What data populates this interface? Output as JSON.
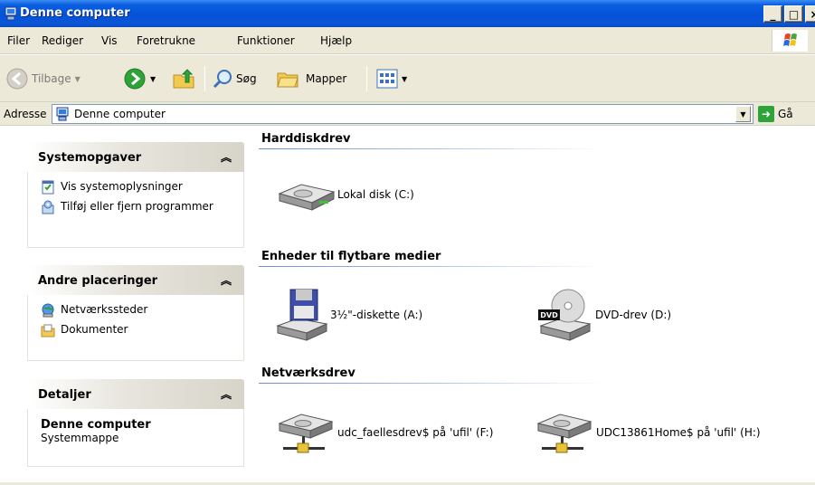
{
  "window": {
    "title": "Denne computer"
  },
  "menubar": {
    "items": [
      {
        "label": "Filer"
      },
      {
        "label": "Rediger"
      },
      {
        "label": "Vis"
      },
      {
        "label": "Foretrukne"
      },
      {
        "label": "Funktioner"
      },
      {
        "label": "Hjælp"
      }
    ]
  },
  "toolbar": {
    "back_label": "Tilbage",
    "search_label": "Søg",
    "folders_label": "Mapper"
  },
  "address": {
    "label": "Adresse",
    "value": "Denne computer",
    "go_label": "Gå"
  },
  "taskpane": {
    "system": {
      "title": "Systemopgaver",
      "items": [
        {
          "label": "Vis systemoplysninger",
          "icon": "system-info-icon"
        },
        {
          "label": "Tilføj eller fjern programmer",
          "icon": "add-remove-programs-icon"
        }
      ]
    },
    "places": {
      "title": "Andre placeringer",
      "items": [
        {
          "label": "Netværkssteder",
          "icon": "network-places-icon"
        },
        {
          "label": "Dokumenter",
          "icon": "documents-folder-icon"
        }
      ]
    },
    "details": {
      "title": "Detaljer",
      "name": "Denne computer",
      "sub": "Systemmappe"
    }
  },
  "content": {
    "harddisks": {
      "title": "Harddiskdrev",
      "items": [
        {
          "label": "Lokal disk (C:)",
          "icon": "hard-disk-icon"
        }
      ]
    },
    "removable": {
      "title": "Enheder til flytbare medier",
      "items": [
        {
          "label": "3½\"-diskette (A:)",
          "icon": "floppy-drive-icon"
        },
        {
          "label": "DVD-drev (D:)",
          "icon": "dvd-drive-icon"
        }
      ]
    },
    "network": {
      "title": "Netværksdrev",
      "items": [
        {
          "label": "udc_faellesdrev$ på 'ufil' (F:)",
          "icon": "network-drive-icon"
        },
        {
          "label": "UDC13861Home$ på 'ufil' (H:)",
          "icon": "network-drive-icon"
        }
      ]
    }
  },
  "colors": {
    "titlebar": "#0452d8",
    "chrome": "#ece9d8",
    "section_line": "#6b8fd8"
  }
}
